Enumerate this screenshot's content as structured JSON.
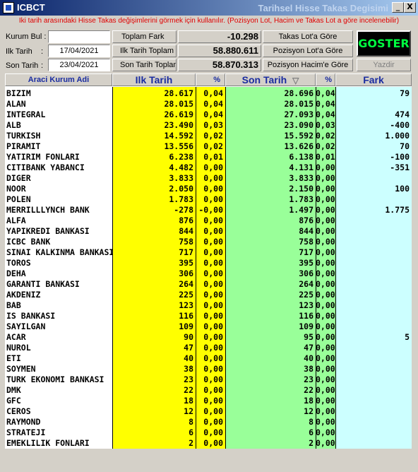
{
  "window": {
    "app_title": "ICBCT",
    "title": "Tarihsel Hisse Takas Degisimi",
    "minimize": "_",
    "close": "X"
  },
  "info_text": "İki tarih arasındaki Hisse Takas değişimlerini görmek için kullanılır. (Pozisyon Lot, Hacim ve Takas Lot a göre incelenebilir)",
  "form": {
    "kurum_label": "Kurum Bul :",
    "kurum_value": "",
    "ilk_tarih_label": "Ilk Tarih",
    "son_tarih_label": "Son Tarih",
    "colon": ":",
    "ilk_tarih": "17/04/2021",
    "son_tarih": "23/04/2021"
  },
  "totals": {
    "toplam_fark_label": "Toplam Fark",
    "toplam_fark": "-10.298",
    "ilk_toplam_label": "Ilk Tarih Toplam",
    "ilk_toplam": "58.880.611",
    "son_toplam_label": "Son Tarih Toplam",
    "son_toplam": "58.870.313"
  },
  "modes": {
    "takas_lot": "Takas Lot'a Göre",
    "pozisyon_lot": "Pozisyon Lot'a Göre",
    "pozisyon_hacim": "Pozisyon Hacim'e Göre"
  },
  "actions": {
    "goster": "GOSTER",
    "yazdir": "Yazdir"
  },
  "columns": {
    "name": "Araci Kurum Adi",
    "ilk": "Ilk Tarih",
    "pct1": "%",
    "son": "Son Tarih",
    "sort_icon": "▽",
    "pct2": "%",
    "fark": "Fark"
  },
  "colors": {
    "yellow": "#ffff00",
    "green": "#99ff99",
    "cyan": "#ccffff",
    "header_text": "#1a2ca0",
    "info_red": "#e00000",
    "goster_green": "#00ff40"
  },
  "rows": [
    {
      "name": "BIZIM",
      "ilk": "28.617",
      "p1": "0,04",
      "son": "28.696",
      "p2": "0,04",
      "fark": "79"
    },
    {
      "name": "ALAN",
      "ilk": "28.015",
      "p1": "0,04",
      "son": "28.015",
      "p2": "0,04",
      "fark": ""
    },
    {
      "name": "INTEGRAL",
      "ilk": "26.619",
      "p1": "0,04",
      "son": "27.093",
      "p2": "0,04",
      "fark": "474"
    },
    {
      "name": "ALB",
      "ilk": "23.490",
      "p1": "0,03",
      "son": "23.090",
      "p2": "0,03",
      "fark": "-400"
    },
    {
      "name": "TURKISH",
      "ilk": "14.592",
      "p1": "0,02",
      "son": "15.592",
      "p2": "0,02",
      "fark": "1.000"
    },
    {
      "name": "PIRAMIT",
      "ilk": "13.556",
      "p1": "0,02",
      "son": "13.626",
      "p2": "0,02",
      "fark": "70"
    },
    {
      "name": "YATIRIM FONLARI",
      "ilk": "6.238",
      "p1": "0,01",
      "son": "6.138",
      "p2": "0,01",
      "fark": "-100"
    },
    {
      "name": "CITIBANK YABANCI",
      "ilk": "4.482",
      "p1": "0,00",
      "son": "4.131",
      "p2": "0,00",
      "fark": "-351"
    },
    {
      "name": "DIGER",
      "ilk": "3.833",
      "p1": "0,00",
      "son": "3.833",
      "p2": "0,00",
      "fark": ""
    },
    {
      "name": "NOOR",
      "ilk": "2.050",
      "p1": "0,00",
      "son": "2.150",
      "p2": "0,00",
      "fark": "100"
    },
    {
      "name": "POLEN",
      "ilk": "1.783",
      "p1": "0,00",
      "son": "1.783",
      "p2": "0,00",
      "fark": ""
    },
    {
      "name": "MERRILLLYNCH BANK",
      "ilk": "-278",
      "p1": "-0,00",
      "son": "1.497",
      "p2": "0,00",
      "fark": "1.775"
    },
    {
      "name": "ALFA",
      "ilk": "876",
      "p1": "0,00",
      "son": "876",
      "p2": "0,00",
      "fark": ""
    },
    {
      "name": "YAPIKREDI BANKASI",
      "ilk": "844",
      "p1": "0,00",
      "son": "844",
      "p2": "0,00",
      "fark": ""
    },
    {
      "name": "ICBC BANK",
      "ilk": "758",
      "p1": "0,00",
      "son": "758",
      "p2": "0,00",
      "fark": ""
    },
    {
      "name": "SINAI KALKINMA BANKASI",
      "ilk": "717",
      "p1": "0,00",
      "son": "717",
      "p2": "0,00",
      "fark": ""
    },
    {
      "name": "TOROS",
      "ilk": "395",
      "p1": "0,00",
      "son": "395",
      "p2": "0,00",
      "fark": ""
    },
    {
      "name": "DEHA",
      "ilk": "306",
      "p1": "0,00",
      "son": "306",
      "p2": "0,00",
      "fark": ""
    },
    {
      "name": "GARANTI BANKASI",
      "ilk": "264",
      "p1": "0,00",
      "son": "264",
      "p2": "0,00",
      "fark": ""
    },
    {
      "name": "AKDENIZ",
      "ilk": "225",
      "p1": "0,00",
      "son": "225",
      "p2": "0,00",
      "fark": ""
    },
    {
      "name": "BAB",
      "ilk": "123",
      "p1": "0,00",
      "son": "123",
      "p2": "0,00",
      "fark": ""
    },
    {
      "name": "IS BANKASI",
      "ilk": "116",
      "p1": "0,00",
      "son": "116",
      "p2": "0,00",
      "fark": ""
    },
    {
      "name": "SAYILGAN",
      "ilk": "109",
      "p1": "0,00",
      "son": "109",
      "p2": "0,00",
      "fark": ""
    },
    {
      "name": "ACAR",
      "ilk": "90",
      "p1": "0,00",
      "son": "95",
      "p2": "0,00",
      "fark": "5"
    },
    {
      "name": "NUROL",
      "ilk": "47",
      "p1": "0,00",
      "son": "47",
      "p2": "0,00",
      "fark": ""
    },
    {
      "name": "ETI",
      "ilk": "40",
      "p1": "0,00",
      "son": "40",
      "p2": "0,00",
      "fark": ""
    },
    {
      "name": "SOYMEN",
      "ilk": "38",
      "p1": "0,00",
      "son": "38",
      "p2": "0,00",
      "fark": ""
    },
    {
      "name": "TURK EKONOMI BANKASI",
      "ilk": "23",
      "p1": "0,00",
      "son": "23",
      "p2": "0,00",
      "fark": ""
    },
    {
      "name": "DMK",
      "ilk": "22",
      "p1": "0,00",
      "son": "22",
      "p2": "0,00",
      "fark": ""
    },
    {
      "name": "GFC",
      "ilk": "18",
      "p1": "0,00",
      "son": "18",
      "p2": "0,00",
      "fark": ""
    },
    {
      "name": "CEROS",
      "ilk": "12",
      "p1": "0,00",
      "son": "12",
      "p2": "0,00",
      "fark": ""
    },
    {
      "name": "RAYMOND",
      "ilk": "8",
      "p1": "0,00",
      "son": "8",
      "p2": "0,00",
      "fark": ""
    },
    {
      "name": "STRATEJI",
      "ilk": "6",
      "p1": "0,00",
      "son": "6",
      "p2": "0,00",
      "fark": ""
    },
    {
      "name": "EMEKLILIK FONLARI",
      "ilk": "2",
      "p1": "0,00",
      "son": "2",
      "p2": "0,00",
      "fark": ""
    }
  ]
}
